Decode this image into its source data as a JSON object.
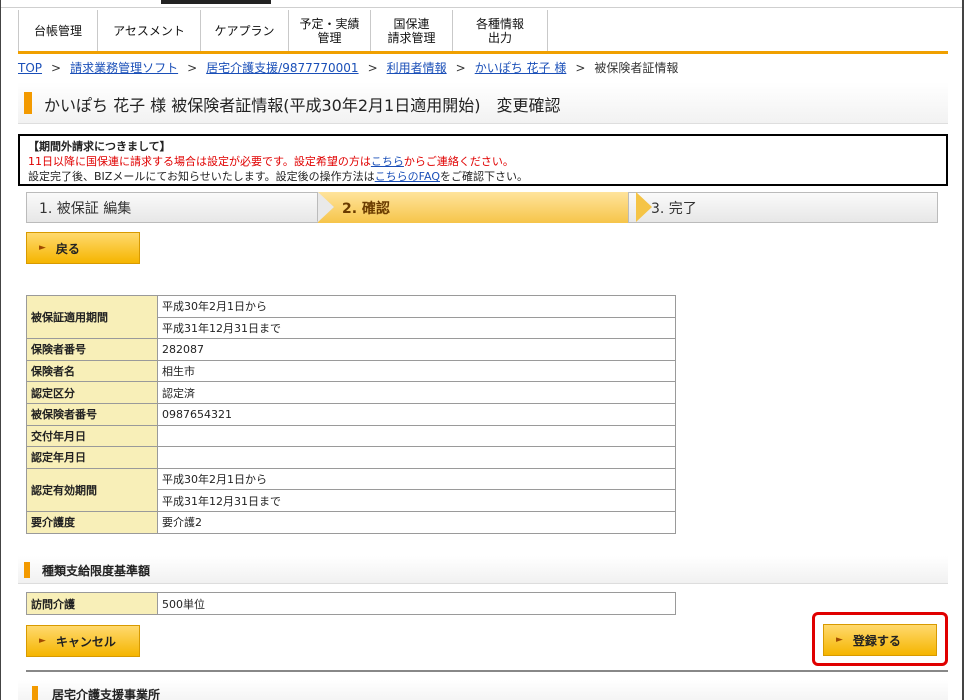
{
  "menu": {
    "items": [
      {
        "label": "台帳管理"
      },
      {
        "label": "アセスメント"
      },
      {
        "label": "ケアプラン"
      },
      {
        "label": "予定・実績\n管理"
      },
      {
        "label": "国保連\n請求管理"
      },
      {
        "label": "各種情報\n出力"
      }
    ]
  },
  "breadcrumb": {
    "top": "TOP",
    "c1": "請求業務管理ソフト",
    "c2": "居宅介護支援/9877770001",
    "c3": "利用者情報",
    "c4": "かいぽち 花子 様",
    "current": "被保険者証情報"
  },
  "page_title": "かいぽち 花子 様 被保険者証情報(平成30年2月1日適用開始)　変更確認",
  "notice": {
    "heading": "【期間外請求につきまして】",
    "line1_a": "11日以降に国保連に請求する場合は設定が必要です。設定希望の方は",
    "line1_link": "こちら",
    "line1_b": "からご連絡ください。",
    "line2_a": "設定完了後、BIZメールにてお知らせいたします。設定後の操作方法は",
    "line2_link": "こちらのFAQ",
    "line2_b": "をご確認下さい。"
  },
  "steps": {
    "s1": "1. 被保証 編集",
    "s2": "2. 確認",
    "s3": "3. 完了"
  },
  "buttons": {
    "back": "戻る",
    "cancel": "キャンセル",
    "register": "登録する"
  },
  "insurance": {
    "period_label": "被保証適用期間",
    "period_from": "平成30年2月1日から",
    "period_to": "平成31年12月31日まで",
    "insurer_no_label": "保険者番号",
    "insurer_no": "282087",
    "insurer_name_label": "保険者名",
    "insurer_name": "相生市",
    "cert_class_label": "認定区分",
    "cert_class": "認定済",
    "insured_no_label": "被保険者番号",
    "insured_no": "0987654321",
    "issue_date_label": "交付年月日",
    "issue_date": "",
    "cert_date_label": "認定年月日",
    "cert_date": "",
    "valid_label": "認定有効期間",
    "valid_from": "平成30年2月1日から",
    "valid_to": "平成31年12月31日まで",
    "care_level_label": "要介護度",
    "care_level": "要介護2"
  },
  "limits": {
    "section_title": "種類支給限度基準額",
    "visit_label": "訪問介護",
    "visit_value": "500単位"
  },
  "next_section": "居宅介護支援事業所",
  "colors": {
    "accent": "#f5b500",
    "highlight": "#e00000",
    "label_bg": "#f8efb8"
  }
}
